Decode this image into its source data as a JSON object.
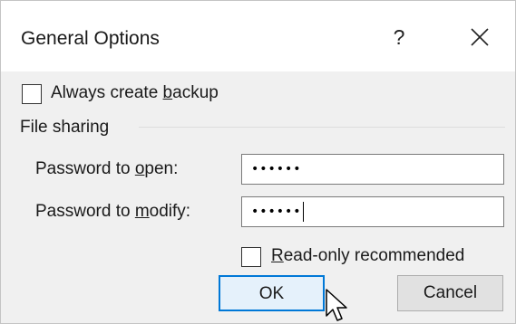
{
  "dialog": {
    "title": "General Options",
    "help_label": "?",
    "close_icon": "close-icon"
  },
  "backup": {
    "label_pre": "Always create ",
    "label_key": "b",
    "label_post": "ackup",
    "checked": false
  },
  "file_sharing": {
    "group_label": "File sharing",
    "open": {
      "label_pre": "Password to ",
      "label_key": "o",
      "label_post": "pen:",
      "value": "••••••"
    },
    "modify": {
      "label_pre": "Password to ",
      "label_key": "m",
      "label_post": "odify:",
      "value": "••••••"
    },
    "readonly": {
      "label_key": "R",
      "label_post": "ead-only recommended",
      "checked": false
    }
  },
  "buttons": {
    "ok": "OK",
    "cancel": "Cancel"
  },
  "colors": {
    "accent": "#0078d7",
    "dialog_bg": "#f0f0f0",
    "titlebar_bg": "#ffffff"
  },
  "cursor_icon": "mouse-pointer-icon"
}
